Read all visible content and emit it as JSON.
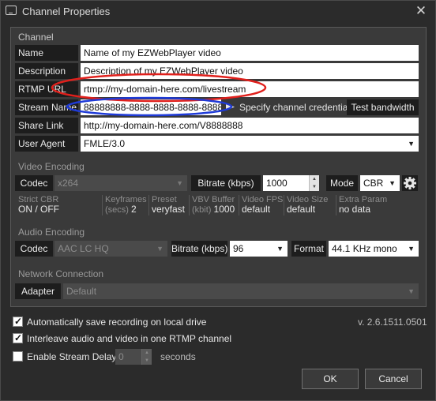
{
  "window": {
    "title": "Channel Properties",
    "close_glyph": "✕"
  },
  "channel": {
    "section": "Channel",
    "name_label": "Name",
    "name_value": "Name of my EZWebPlayer video",
    "desc_label": "Description",
    "desc_value": "Description of my EZWebPlayer video",
    "rtmp_label": "RTMP URL",
    "rtmp_value": "rtmp://my-domain-here.com/livestream",
    "stream_label": "Stream Name",
    "stream_value": "88888888-8888-8888-8888-88888888",
    "credentials_label": "Specify channel credentials",
    "test_bandwidth": "Test bandwidth",
    "share_label": "Share Link",
    "share_value": "http://my-domain-here.com/V8888888",
    "agent_label": "User Agent",
    "agent_value": "FMLE/3.0"
  },
  "video": {
    "section": "Video Encoding",
    "codec_label": "Codec",
    "codec_value": "x264",
    "bitrate_label": "Bitrate (kbps)",
    "bitrate_value": "1000",
    "mode_label": "Mode",
    "mode_value": "CBR",
    "strict_top": "Strict CBR",
    "strict_val": "ON / OFF",
    "keyframes_top": "Keyframes",
    "keyframes_unit": "(secs)",
    "keyframes_val": "2",
    "preset_top": "Preset",
    "preset_val": "veryfast",
    "vbv_top": "VBV Buffer",
    "vbv_unit": "(kbit)",
    "vbv_val": "1000",
    "fps_top": "Video FPS",
    "fps_val": "default",
    "size_top": "Video Size",
    "size_val": "default",
    "extra_top": "Extra Param",
    "extra_val": "no data"
  },
  "audio": {
    "section": "Audio Encoding",
    "codec_label": "Codec",
    "codec_value": "AAC LC HQ",
    "bitrate_label": "Bitrate (kbps)",
    "bitrate_value": "96",
    "format_label": "Format",
    "format_value": "44.1 KHz mono"
  },
  "network": {
    "section": "Network Connection",
    "adapter_label": "Adapter",
    "adapter_value": "Default"
  },
  "options": {
    "autosave_label": "Automatically save recording on local drive",
    "autosave_checked": true,
    "interleave_label": "Interleave audio and video in one RTMP channel",
    "interleave_checked": true,
    "delay_label": "Enable Stream Delay",
    "delay_checked": false,
    "delay_value": "0",
    "delay_unit": "seconds",
    "version": "v. 2.6.1511.0501"
  },
  "buttons": {
    "ok": "OK",
    "cancel": "Cancel"
  },
  "annotations": {
    "red_ellipse": "#e0201c",
    "blue_ellipse": "#1f3bd8"
  }
}
